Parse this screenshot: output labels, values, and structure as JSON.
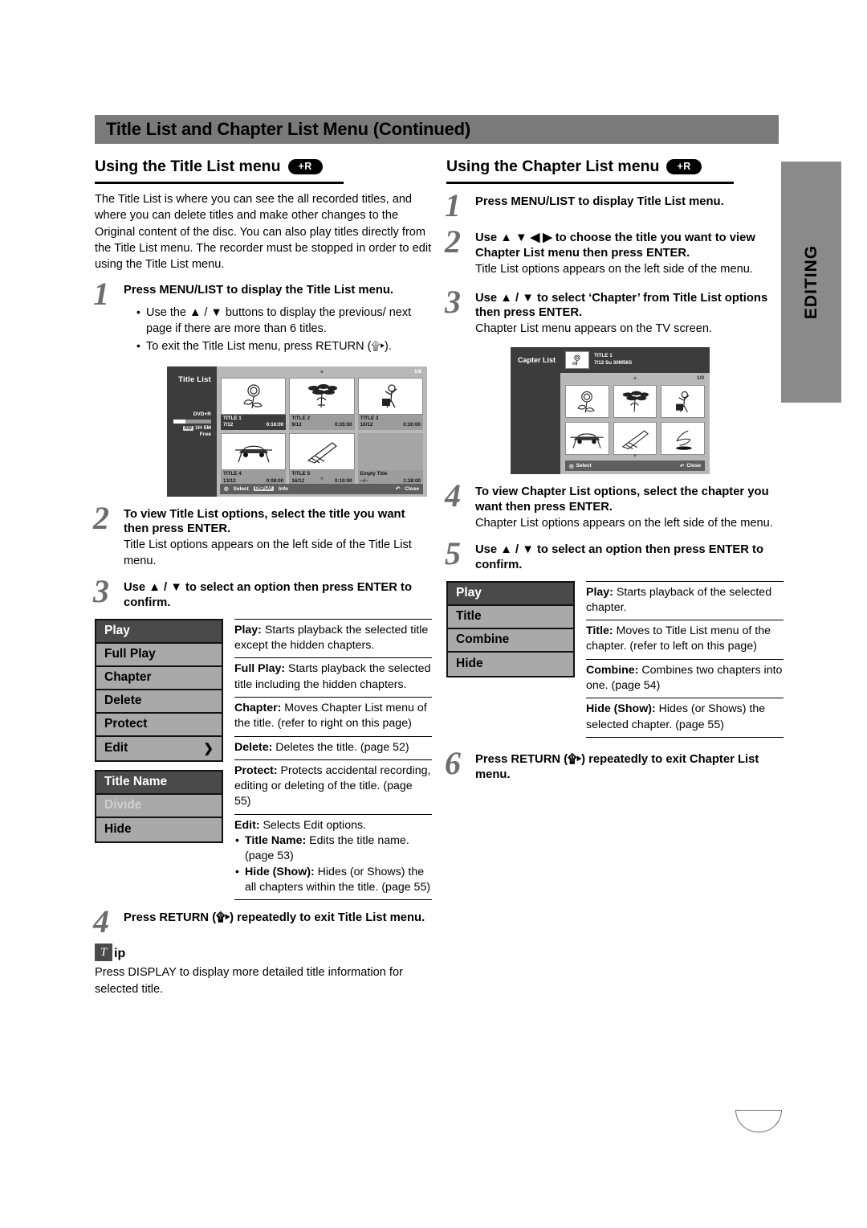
{
  "header": {
    "title": "Title List and Chapter List Menu (Continued)"
  },
  "side_tab": {
    "label": "EDITING"
  },
  "left_column": {
    "section_title": "Using the Title List menu",
    "badge": "+R",
    "intro": "The Title List is where you can see the all recorded titles, and where you can delete titles and make other changes to the Original content of the disc. You can also play titles directly from the Title List menu. The recorder must be stopped in order to edit using the Title List menu.",
    "steps": [
      {
        "num": "1",
        "title": "Press MENU/LIST to display the Title List menu.",
        "bullets": [
          "Use the ▲ / ▼ buttons to display the previous/ next page if there are more than 6 titles.",
          "To exit the Title List menu, press RETURN (۩▸)."
        ]
      },
      {
        "num": "2",
        "title": "To view Title List options, select the title you want then press ENTER.",
        "sub": "Title List options appears on the left side of the Title List menu."
      },
      {
        "num": "3",
        "title": "Use ▲ / ▼ to select an option then press ENTER to confirm."
      },
      {
        "num": "4",
        "title": "Press RETURN (۩▸) repeatedly to exit Title List menu."
      }
    ],
    "tv_screen": {
      "side_label": "Title List",
      "disc_type": "DVD+R",
      "free_chip": "RW",
      "free_label": "1H 5M",
      "free_word": "Free",
      "page_indicator": "1/8",
      "titles": [
        {
          "name": "TITLE 1",
          "date": "7/12",
          "length": "0:16:00",
          "selected": true,
          "icon": "rose-icon"
        },
        {
          "name": "TITLE 2",
          "date": "9/12",
          "length": "0:35:00",
          "selected": false,
          "icon": "tree-icon"
        },
        {
          "name": "TITLE 3",
          "date": "10/12",
          "length": "0:30:00",
          "selected": false,
          "icon": "figure-icon"
        },
        {
          "name": "TITLE 4",
          "date": "13/12",
          "length": "0:08:00",
          "selected": false,
          "icon": "car-icon"
        },
        {
          "name": "TITLE 5",
          "date": "16/12",
          "length": "0:10:00",
          "selected": false,
          "icon": "shuttle-icon"
        },
        {
          "name": "Empty Title",
          "date": "--/--",
          "length": "1:38:00",
          "selected": false,
          "icon": "empty-icon"
        }
      ],
      "footer_select": "Select",
      "footer_display_chip": "DISPLAY",
      "footer_info": "Info",
      "footer_close": "Close"
    },
    "options": [
      {
        "label": "Play",
        "selected": true,
        "disabled": false,
        "chevron": false
      },
      {
        "label": "Full Play",
        "selected": false,
        "disabled": false,
        "chevron": false
      },
      {
        "label": "Chapter",
        "selected": false,
        "disabled": false,
        "chevron": false
      },
      {
        "label": "Delete",
        "selected": false,
        "disabled": false,
        "chevron": false
      },
      {
        "label": "Protect",
        "selected": false,
        "disabled": false,
        "chevron": false
      },
      {
        "label": "Edit",
        "selected": false,
        "disabled": false,
        "chevron": true
      }
    ],
    "options_secondary": [
      {
        "label": "Title Name",
        "selected": true,
        "disabled": false
      },
      {
        "label": "Divide",
        "selected": false,
        "disabled": true
      },
      {
        "label": "Hide",
        "selected": false,
        "disabled": false
      }
    ],
    "descriptions": [
      {
        "term": "Play:",
        "text": " Starts playback the selected title except the hidden chapters."
      },
      {
        "term": "Full Play:",
        "text": " Starts playback the selected title including the hidden chapters."
      },
      {
        "term": "Chapter:",
        "text": " Moves Chapter List menu of the title. (refer to right on this page)"
      },
      {
        "term": "Delete:",
        "text": " Deletes the title. (page 52)"
      },
      {
        "term": "Protect:",
        "text": " Protects accidental recording, editing or deleting of the title. (page 55)"
      },
      {
        "term": "Edit:",
        "text": " Selects Edit options."
      }
    ],
    "edit_subitems": [
      {
        "term": "Title Name:",
        "text": " Edits the title name. (page 53)"
      },
      {
        "term": "Hide (Show):",
        "text": " Hides (or Shows) the all chapters within the title. (page 55)"
      }
    ],
    "tip": {
      "badge_letter": "T",
      "word": "ip",
      "body": "Press DISPLAY to display more detailed title information for selected title."
    }
  },
  "right_column": {
    "section_title": "Using the Chapter List menu",
    "badge": "+R",
    "steps": [
      {
        "num": "1",
        "title": "Press MENU/LIST to display Title List menu."
      },
      {
        "num": "2",
        "title": "Use ▲ ▼ ◀ ▶ to choose the title you want to view Chapter List menu then press ENTER.",
        "sub": "Title List options appears on the left side of the menu."
      },
      {
        "num": "3",
        "title": "Use ▲ / ▼ to select ‘Chapter’ from Title List options then press ENTER.",
        "sub": "Chapter List menu appears on the TV screen."
      },
      {
        "num": "4",
        "title": "To view Chapter List options, select the chapter you want then press ENTER.",
        "sub": "Chapter List options appears on the left side of the menu."
      },
      {
        "num": "5",
        "title": "Use ▲ / ▼ to select an option then press ENTER to confirm."
      },
      {
        "num": "6",
        "title": "Press RETURN (۩▸) repeatedly to exit Chapter List menu."
      }
    ],
    "tv_screen": {
      "side_label": "Capter List",
      "title_name": "TITLE 1",
      "title_meta": "7/12  Su    30M56S",
      "page_indicator": "1/9",
      "chapters": [
        {
          "icon": "rose-icon"
        },
        {
          "icon": "tree-icon"
        },
        {
          "icon": "figure-icon"
        },
        {
          "icon": "car-icon"
        },
        {
          "icon": "shuttle-icon"
        },
        {
          "icon": "bird-icon"
        }
      ],
      "footer_select": "Select",
      "footer_close": "Close"
    },
    "options": [
      {
        "label": "Play",
        "selected": true,
        "disabled": false
      },
      {
        "label": "Title",
        "selected": false,
        "disabled": false
      },
      {
        "label": "Combine",
        "selected": false,
        "disabled": false
      },
      {
        "label": "Hide",
        "selected": false,
        "disabled": false
      }
    ],
    "descriptions": [
      {
        "term": "Play:",
        "text": " Starts playback of the selected chapter."
      },
      {
        "term": "Title:",
        "text": " Moves to Title List menu of the chapter. (refer to left on this page)"
      },
      {
        "term": "Combine:",
        "text": " Combines two chapters into one. (page 54)"
      },
      {
        "term": "Hide (Show):",
        "text": " Hides (or Shows) the selected chapter. (page 55)"
      }
    ]
  }
}
